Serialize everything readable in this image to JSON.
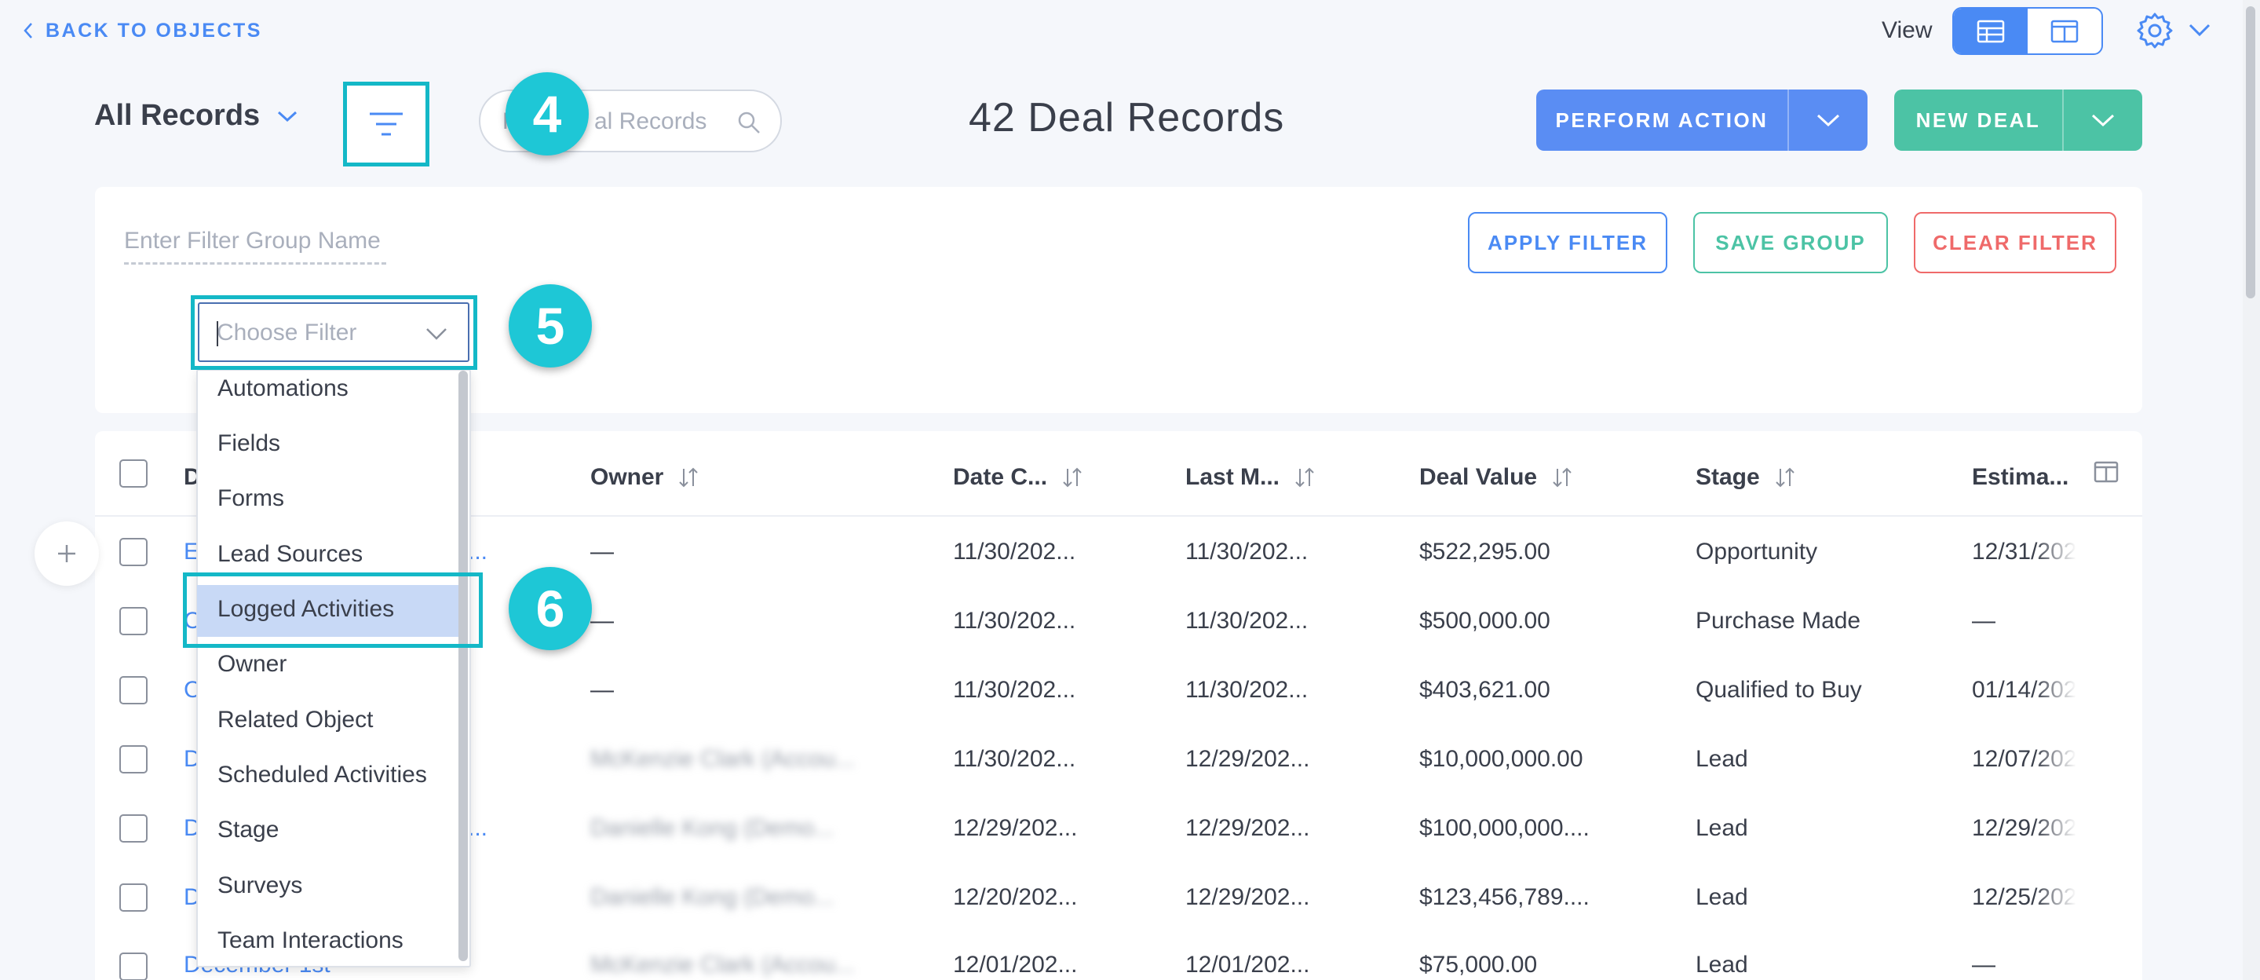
{
  "header": {
    "back_label": "BACK TO OBJECTS",
    "view_label": "View"
  },
  "toolbar": {
    "records_selector": "All Records",
    "search_placeholder": "Search Deal Records",
    "search_visible": [
      "F",
      "al Records"
    ],
    "records_count": "42 Deal Records",
    "perform_action": "PERFORM ACTION",
    "new_deal": "NEW DEAL"
  },
  "filter_panel": {
    "group_name_placeholder": "Enter Filter Group Name",
    "apply": "APPLY FILTER",
    "save": "SAVE GROUP",
    "clear": "CLEAR FILTER",
    "choose_placeholder": "Choose Filter",
    "options": [
      "Automations",
      "Fields",
      "Forms",
      "Lead Sources",
      "Logged Activities",
      "Owner",
      "Related Object",
      "Scheduled Activities",
      "Stage",
      "Surveys",
      "Team Interactions"
    ],
    "highlighted_option": "Logged Activities"
  },
  "steps": [
    "4",
    "5",
    "6"
  ],
  "table": {
    "columns": [
      "D",
      "Owner",
      "Date C...",
      "Last M...",
      "Deal Value",
      "Stage",
      "Estima..."
    ],
    "rows": [
      {
        "name": "E",
        "owner": "—",
        "created": "11/30/202...",
        "modified": "11/30/202...",
        "value": "$522,295.00",
        "stage": "Opportunity",
        "estimated": "12/31/202"
      },
      {
        "name": "C",
        "owner": "—",
        "created": "11/30/202...",
        "modified": "11/30/202...",
        "value": "$500,000.00",
        "stage": "Purchase Made",
        "estimated": "—"
      },
      {
        "name": "C",
        "owner": "—",
        "created": "11/30/202...",
        "modified": "11/30/202...",
        "value": "$403,621.00",
        "stage": "Qualified to Buy",
        "estimated": "01/14/202"
      },
      {
        "name": "D",
        "owner": "McKenzie Clark (Accou...",
        "created": "11/30/202...",
        "modified": "12/29/202...",
        "value": "$10,000,000.00",
        "stage": "Lead",
        "estimated": "12/07/202"
      },
      {
        "name": "D",
        "owner": "Danielle Kong (Demo...",
        "created": "12/29/202...",
        "modified": "12/29/202...",
        "value": "$100,000,000....",
        "stage": "Lead",
        "estimated": "12/29/202"
      },
      {
        "name": "D",
        "owner": "Danielle Kong (Demo...",
        "created": "12/20/202...",
        "modified": "12/29/202...",
        "value": "$123,456,789....",
        "stage": "Lead",
        "estimated": "12/25/202"
      },
      {
        "name": "December 1st",
        "owner": "McKenzie Clark (Accou...",
        "created": "12/01/202...",
        "modified": "12/01/202...",
        "value": "$75,000.00",
        "stage": "Lead",
        "estimated": "—"
      }
    ]
  },
  "colors": {
    "accent_blue": "#4a8af4",
    "accent_green": "#4cc3a5",
    "danger_red": "#ef6a6a",
    "highlight_teal": "#14b8c7",
    "badge_teal": "#1ec7d6"
  }
}
